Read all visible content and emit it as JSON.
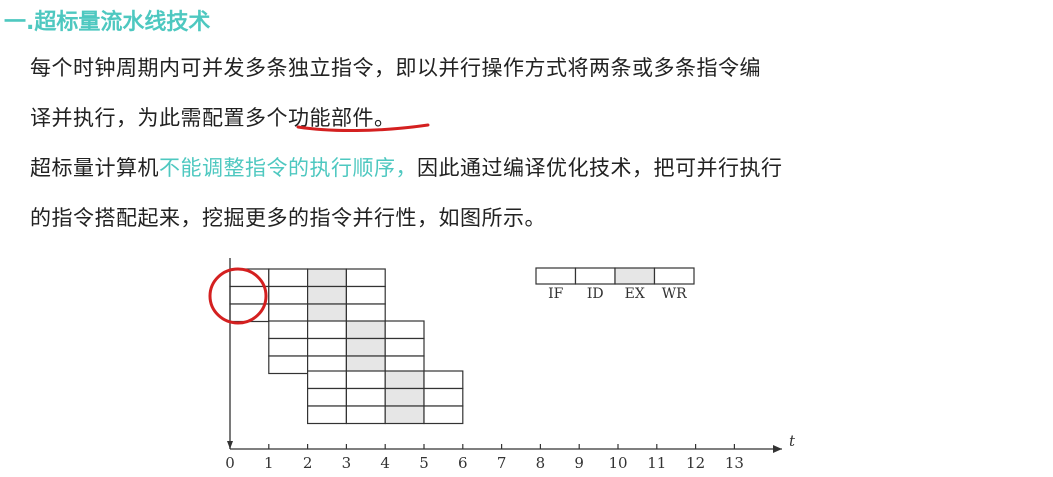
{
  "heading": "一.超标量流水线技术",
  "para1": {
    "line1": "每个时钟周期内可并发多条独立指令，即以并行操作方式将两条或多条指令编",
    "line2_before": "译并执行，为此需配置",
    "line2_underlined": "多个功能部",
    "line2_after": "件。"
  },
  "para2": {
    "line1_before": "超标量计算机",
    "line1_highlight": "不能调整指令的执行顺序，",
    "line1_after": "因此通过编译优化技术，把可并行执行",
    "line2": "的指令搭配起来，挖掘更多的指令并行性，如图所示。"
  },
  "figure": {
    "legend": [
      "IF",
      "ID",
      "EX",
      "WR"
    ],
    "x_ticks": [
      "0",
      "1",
      "2",
      "3",
      "4",
      "5",
      "6",
      "7",
      "8",
      "9",
      "10",
      "11",
      "12",
      "13"
    ],
    "x_axis_label": "t",
    "instruction_groups": 3,
    "instructions_per_group": 3,
    "stages": [
      "IF",
      "ID",
      "EX",
      "WR"
    ],
    "shaded_stage": "EX",
    "annotation_color": "#d42020",
    "shade_color": "#e6e6e6"
  }
}
